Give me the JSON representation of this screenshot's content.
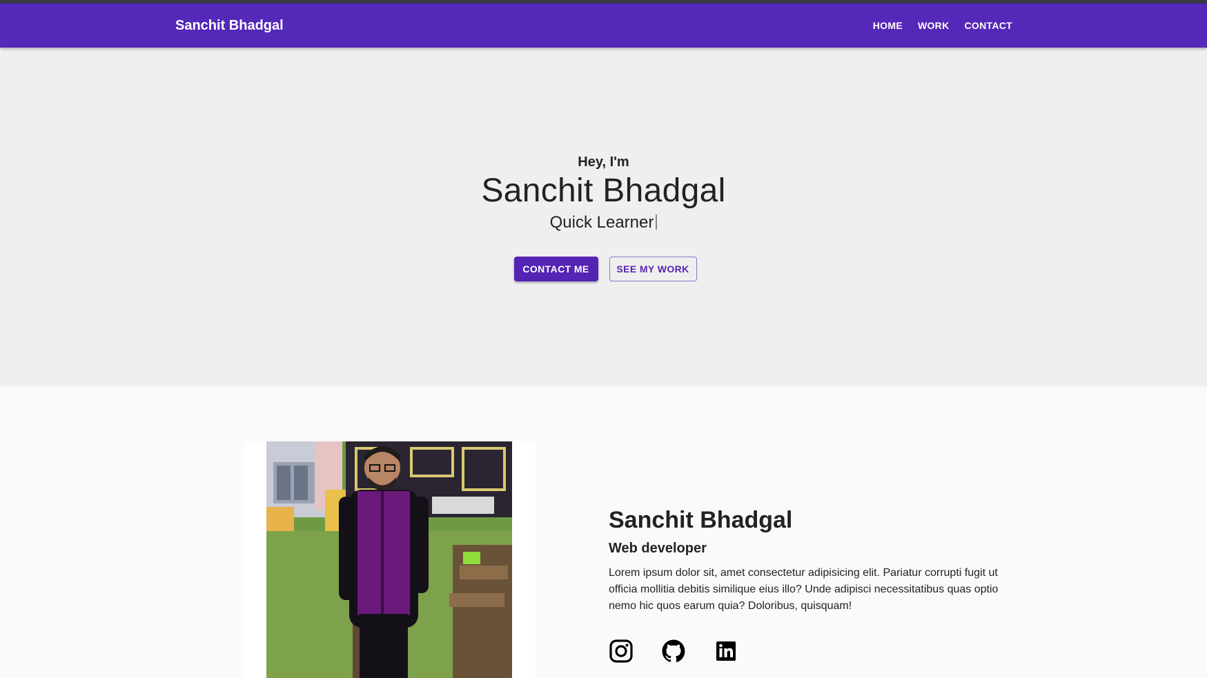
{
  "navbar": {
    "brand": "Sanchit Bhadgal",
    "links": [
      "HOME",
      "WORK",
      "CONTACT"
    ]
  },
  "hero": {
    "greeting": "Hey, I'm",
    "name": "Sanchit Bhadgal",
    "tagline": "Quick Learner",
    "contact_button": "CONTACT ME",
    "work_button": "SEE MY WORK"
  },
  "about": {
    "name": "Sanchit Bhadgal",
    "role": "Web developer",
    "description": "Lorem ipsum dolor sit, amet consectetur adipisicing elit. Pariatur corrupti fugit ut officia mollitia debitis similique eius illo? Unde adipisci necessitatibus quas optio nemo hic quos earum quia? Doloribus, quisquam!",
    "socials": [
      "instagram-icon",
      "github-icon",
      "linkedin-icon"
    ]
  },
  "colors": {
    "primary": "#5428b8",
    "hero_background": "#efefef",
    "page_background": "#fafafa"
  }
}
